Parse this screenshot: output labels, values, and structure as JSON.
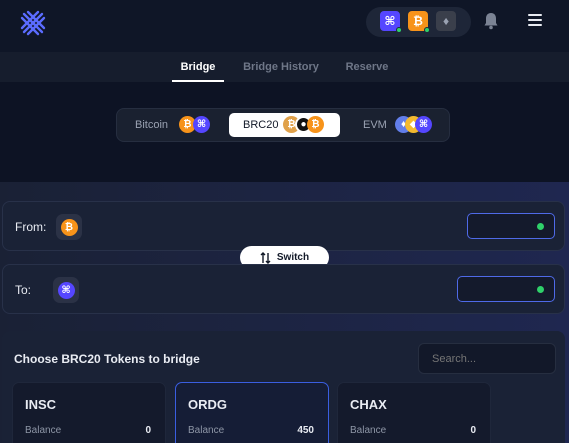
{
  "header": {
    "chains": [
      {
        "icon": "stacks-icon",
        "glyph": "⌘",
        "color": "#5546ff",
        "connected": true
      },
      {
        "icon": "bitcoin-icon",
        "glyph": "₿",
        "color": "#f7931a",
        "connected": true
      },
      {
        "icon": "ethereum-icon",
        "glyph": "♦",
        "color": "#3a3f4b",
        "connected": false
      }
    ]
  },
  "tabs": [
    {
      "label": "Bridge",
      "active": true
    },
    {
      "label": "Bridge History",
      "active": false
    },
    {
      "label": "Reserve",
      "active": false
    }
  ],
  "bridge_types": [
    {
      "label": "Bitcoin",
      "active": false
    },
    {
      "label": "BRC20",
      "active": true
    },
    {
      "label": "EVM",
      "active": false
    }
  ],
  "from": {
    "label": "From:",
    "icon": "bitcoin-icon",
    "glyph": "₿"
  },
  "to": {
    "label": "To:",
    "icon": "stacks-icon",
    "glyph": "⌘"
  },
  "switch": {
    "label": "Switch"
  },
  "choose": {
    "title": "Choose BRC20 Tokens to bridge",
    "search_placeholder": "Search..."
  },
  "tokens": [
    {
      "name": "INSC",
      "balance_label": "Balance",
      "balance": "0",
      "selected": false
    },
    {
      "name": "ORDG",
      "balance_label": "Balance",
      "balance": "450",
      "selected": true
    },
    {
      "name": "CHAX",
      "balance_label": "Balance",
      "balance": "0",
      "selected": false
    }
  ],
  "colors": {
    "accent": "#4f6ae8",
    "bitcoin": "#f7931a",
    "stacks": "#5546ff",
    "online": "#2fd06a"
  }
}
